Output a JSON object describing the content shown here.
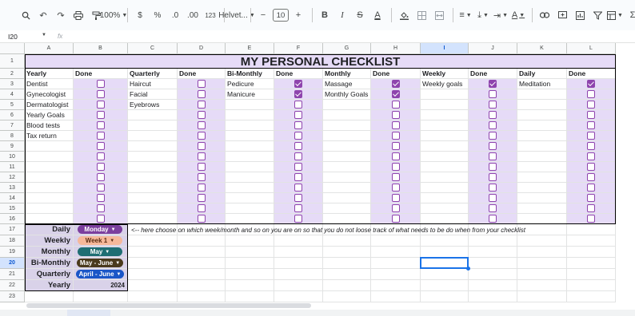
{
  "toolbar": {
    "zoom": "100%",
    "currency": "$",
    "percent": "%",
    "dec_less": ".0",
    "dec_more": ".00",
    "number_format": "123",
    "font": "Helvet...",
    "font_size": "10",
    "bold": "B",
    "italic": "I",
    "strike": "S",
    "text_color": "A",
    "function": "Σ"
  },
  "formula_bar": {
    "name_box": "I20",
    "fx": "fx",
    "content": ""
  },
  "columns": [
    "A",
    "B",
    "C",
    "D",
    "E",
    "F",
    "G",
    "H",
    "I",
    "J",
    "K",
    "L"
  ],
  "rows": [
    "1",
    "2",
    "3",
    "4",
    "5",
    "6",
    "7",
    "8",
    "9",
    "10",
    "11",
    "12",
    "13",
    "14",
    "15",
    "16",
    "17",
    "18",
    "19",
    "20",
    "21",
    "22",
    "23"
  ],
  "selected": {
    "column": "I",
    "row": "20"
  },
  "sheet": {
    "title": "MY PERSONAL CHECKLIST",
    "headers": [
      "Yearly",
      "Done",
      "Quarterly",
      "Done",
      "Bi-Monthly",
      "Done",
      "Monthly",
      "Done",
      "Weekly",
      "Done",
      "Daily",
      "Done"
    ],
    "lists": {
      "yearly": [
        "Dentist",
        "Gynecologist",
        "Dermatologist",
        "Yearly Goals",
        "Blood tests",
        "Tax return"
      ],
      "quarterly": [
        "Haircut",
        "Facial",
        "Eyebrows"
      ],
      "bimonthly": [
        "Pedicure",
        "Manicure"
      ],
      "monthly": [
        "Massage",
        "Monthly Goals"
      ],
      "weekly": [
        "Weekly goals"
      ],
      "daily": [
        "Meditation"
      ]
    },
    "checked": {
      "B": [],
      "D": [],
      "F": [
        0,
        1
      ],
      "H": [
        0,
        1
      ],
      "J": [
        0
      ],
      "L": [
        0
      ]
    },
    "selectors": [
      {
        "label": "Daily",
        "value": "Monday",
        "bg": "#7b3f9e",
        "fg": "#ffffff"
      },
      {
        "label": "Weekly",
        "value": "Week 1",
        "bg": "#f6b89a",
        "fg": "#5a2c14"
      },
      {
        "label": "Monthly",
        "value": "May",
        "bg": "#1f6e73",
        "fg": "#ffffff"
      },
      {
        "label": "Bi-Monthly",
        "value": "May - June",
        "bg": "#4a3a1c",
        "fg": "#ffffff"
      },
      {
        "label": "Quarterly",
        "value": "April - June",
        "bg": "#1a56c7",
        "fg": "#ffffff"
      },
      {
        "label": "Yearly",
        "value": "2024",
        "bg": "",
        "fg": "#000000"
      }
    ],
    "note": "<-- here choose on which week/month and so on you are on so that you do not loose track of what needs to be do when from your checklist"
  },
  "colors": {
    "purple_fill": "#e6dbf7",
    "label_fill": "#d9d2e9",
    "checkbox": "#8e44ad",
    "selection": "#1a73e8"
  }
}
